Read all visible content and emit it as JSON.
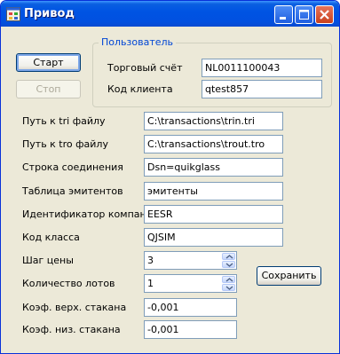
{
  "window": {
    "title": "Привод"
  },
  "user_group": {
    "legend": "Пользователь",
    "account_label": "Торговый счёт",
    "account_value": "NL0011100043",
    "client_label": "Код клиента",
    "client_value": "qtest857"
  },
  "buttons": {
    "start": "Старт",
    "stop": "Стоп",
    "save": "Сохранить"
  },
  "fields": [
    {
      "label": "Путь к tri файлу",
      "value": "C:\\transactions\\trin.tri"
    },
    {
      "label": "Путь к tro файлу",
      "value": "C:\\transactions\\trout.tro"
    },
    {
      "label": "Строка соединения",
      "value": "Dsn=quikglass"
    },
    {
      "label": "Таблица эмитентов",
      "value": "эмитенты"
    },
    {
      "label": "Идентификатор компании",
      "value": "EESR"
    },
    {
      "label": "Код класса",
      "value": "QJSIM"
    }
  ],
  "price_step": {
    "label": "Шаг цены",
    "value": "3"
  },
  "lots": {
    "label": "Количество лотов",
    "value": "1"
  },
  "coef_top": {
    "label": "Коэф. верх. стакана",
    "value": "-0,001"
  },
  "coef_bottom": {
    "label": "Коэф. низ. стакана",
    "value": "-0,001"
  }
}
